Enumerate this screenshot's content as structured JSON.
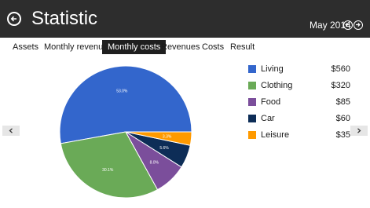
{
  "header": {
    "title": "Statistic",
    "month": "May 2014"
  },
  "tabs": [
    {
      "label": "Assets",
      "active": false
    },
    {
      "label": "Monthly revenue",
      "active": false
    },
    {
      "label": "Monthly costs",
      "active": true
    },
    {
      "label": "Revenues",
      "active": false
    },
    {
      "label": "Costs",
      "active": false
    },
    {
      "label": "Result",
      "active": false
    }
  ],
  "nav": {
    "prev_label": "‹",
    "next_label": "›"
  },
  "chart_data": {
    "type": "pie",
    "slices": [
      {
        "label": "Living",
        "value": 560,
        "display_value": "$560",
        "percent_label": "53.0%",
        "color": "#3366cc"
      },
      {
        "label": "Clothing",
        "value": 320,
        "display_value": "$320",
        "percent_label": "30.1%",
        "color": "#6aaa57"
      },
      {
        "label": "Food",
        "value": 85,
        "display_value": "$85",
        "percent_label": "8.0%",
        "color": "#7b4e9b"
      },
      {
        "label": "Car",
        "value": 60,
        "display_value": "$60",
        "percent_label": "5.6%",
        "color": "#0d2d57"
      },
      {
        "label": "Leisure",
        "value": 35,
        "display_value": "$35",
        "percent_label": "3.3%",
        "color": "#ff9a00"
      }
    ],
    "legend": "right"
  },
  "colors": {
    "header_bg": "#2d2d2d",
    "active_tab_bg": "#1f1f1f"
  }
}
